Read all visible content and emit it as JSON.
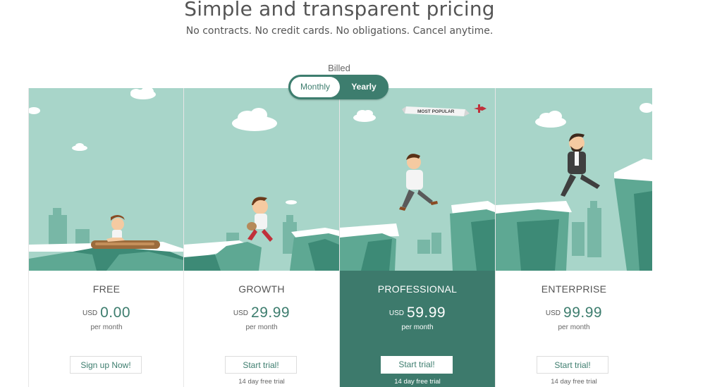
{
  "header": {
    "title": "Simple and transparent pricing",
    "subtitle": "No contracts. No credit cards. No obligations. Cancel anytime."
  },
  "billing": {
    "label": "Billed",
    "options": [
      "Monthly",
      "Yearly"
    ],
    "selected": "Monthly"
  },
  "banner": {
    "text": "MOST POPULAR"
  },
  "colors": {
    "brand": "#3d7d6e",
    "sky": "#a8d5c9",
    "featured_bg": "#3d7a6c"
  },
  "plans": [
    {
      "name": "FREE",
      "currency": "USD",
      "price": "0.00",
      "period": "per month",
      "button": "Sign up Now!",
      "trial": ""
    },
    {
      "name": "GROWTH",
      "currency": "USD",
      "price": "29.99",
      "period": "per month",
      "button": "Start trial!",
      "trial": "14 day free trial"
    },
    {
      "name": "PROFESSIONAL",
      "currency": "USD",
      "price": "59.99",
      "period": "per month",
      "button": "Start trial!",
      "trial": "14 day free trial",
      "featured": true
    },
    {
      "name": "ENTERPRISE",
      "currency": "USD",
      "price": "99.99",
      "period": "per month",
      "button": "Start trial!",
      "trial": "14 day free trial"
    }
  ]
}
